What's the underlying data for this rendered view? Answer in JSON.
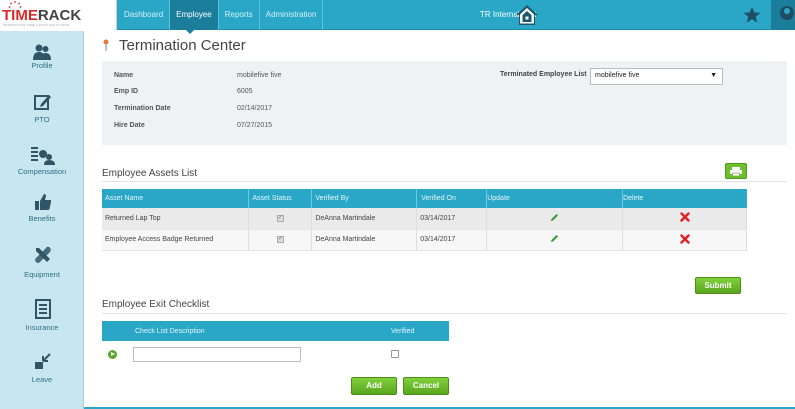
{
  "brand": {
    "name_part1": "TIME",
    "name_part2": "RACK",
    "tagline": "PRODUCTIVE TIME CLOCK SOLUTIONS"
  },
  "nav": {
    "items": [
      {
        "label": "Dashboard"
      },
      {
        "label": "Employee"
      },
      {
        "label": "Reports"
      },
      {
        "label": "Administration"
      }
    ],
    "active": "Employee",
    "company": "TR Internal Test"
  },
  "sidebar": {
    "items": [
      {
        "label": "Profile",
        "icon": "profile-icon"
      },
      {
        "label": "PTO",
        "icon": "edit-icon"
      },
      {
        "label": "Compensation",
        "icon": "compensation-icon"
      },
      {
        "label": "Benefits",
        "icon": "thumbs-up-icon"
      },
      {
        "label": "Equipment",
        "icon": "tools-icon"
      },
      {
        "label": "Insurance",
        "icon": "document-icon"
      },
      {
        "label": "Leave",
        "icon": "leave-icon"
      }
    ]
  },
  "page": {
    "title": "Termination Center"
  },
  "employee": {
    "name_label": "Name",
    "name": "mobilefive five",
    "emp_id_label": "Emp ID",
    "emp_id": "6005",
    "term_date_label": "Termination Date",
    "term_date": "02/14/2017",
    "hire_date_label": "Hire Date",
    "hire_date": "07/27/2015"
  },
  "terminated_list": {
    "label": "Terminated Employee List",
    "selected": "mobilefive five",
    "caret": "▼"
  },
  "assets": {
    "title": "Employee Assets List",
    "columns": [
      "Asset Name",
      "Asset Status",
      "Verified By",
      "Verified On",
      "Update",
      "Delete"
    ],
    "rows": [
      {
        "name": "Returned Lap Top",
        "status_checked": true,
        "verified_by": "DeAnna Martindale",
        "verified_on": "03/14/2017"
      },
      {
        "name": "Employee Access Badge Returned",
        "status_checked": true,
        "verified_by": "DeAnna Martindale",
        "verified_on": "03/14/2017"
      }
    ],
    "submit_label": "Submit"
  },
  "checklist": {
    "title": "Employee Exit Checklist",
    "columns": [
      "Check List Description",
      "Verified"
    ],
    "input_value": "",
    "add_label": "Add",
    "cancel_label": "Cancel"
  },
  "colors": {
    "accent": "#2aa7c7",
    "nav_active": "#1b7f9c",
    "sidebar": "#c7e6ef",
    "button_green": "#6cbf2f",
    "delete_red": "#e02020"
  }
}
